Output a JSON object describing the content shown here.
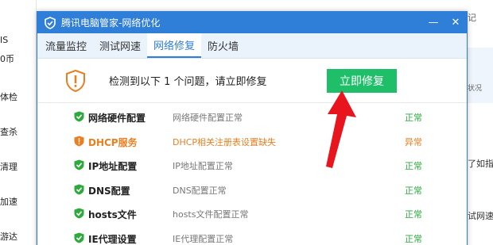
{
  "background": {
    "left_fragments": [
      "IS",
      "0币",
      "体检",
      "查杀",
      "清理",
      "加速",
      "游达"
    ],
    "right_fragments": [
      "记",
      "状况",
      "了如指",
      "试网速"
    ]
  },
  "window": {
    "title": "腾讯电脑管家-网络优化",
    "minimize": "—",
    "close": "✕"
  },
  "tabs": [
    {
      "label": "流量监控",
      "active": false
    },
    {
      "label": "测试网速",
      "active": false
    },
    {
      "label": "网络修复",
      "active": true
    },
    {
      "label": "防火墙",
      "active": false
    }
  ],
  "banner": {
    "message": "检测到以下 1 个问题，请立即修复",
    "fix_button": "立即修复"
  },
  "checks": [
    {
      "name": "网络硬件配置",
      "detail": "网络硬件配置正常",
      "status": "正常",
      "ok": true
    },
    {
      "name": "DHCP服务",
      "detail": "DHCP相关注册表设置缺失",
      "status": "异常",
      "ok": false
    },
    {
      "name": "IP地址配置",
      "detail": "IP地址配置正常",
      "status": "正常",
      "ok": true
    },
    {
      "name": "DNS配置",
      "detail": "DNS配置正常",
      "status": "正常",
      "ok": true
    },
    {
      "name": "hosts文件",
      "detail": "hosts文件配置正常",
      "status": "正常",
      "ok": true
    },
    {
      "name": "IE代理设置",
      "detail": "IE代理配置正常",
      "status": "正常",
      "ok": true
    }
  ],
  "colors": {
    "titlebar": "#2f7ed8",
    "fix_button": "#1fbf6a",
    "ok": "#2eaa3c",
    "warning": "#e87f21",
    "arrow": "#e8141e"
  }
}
